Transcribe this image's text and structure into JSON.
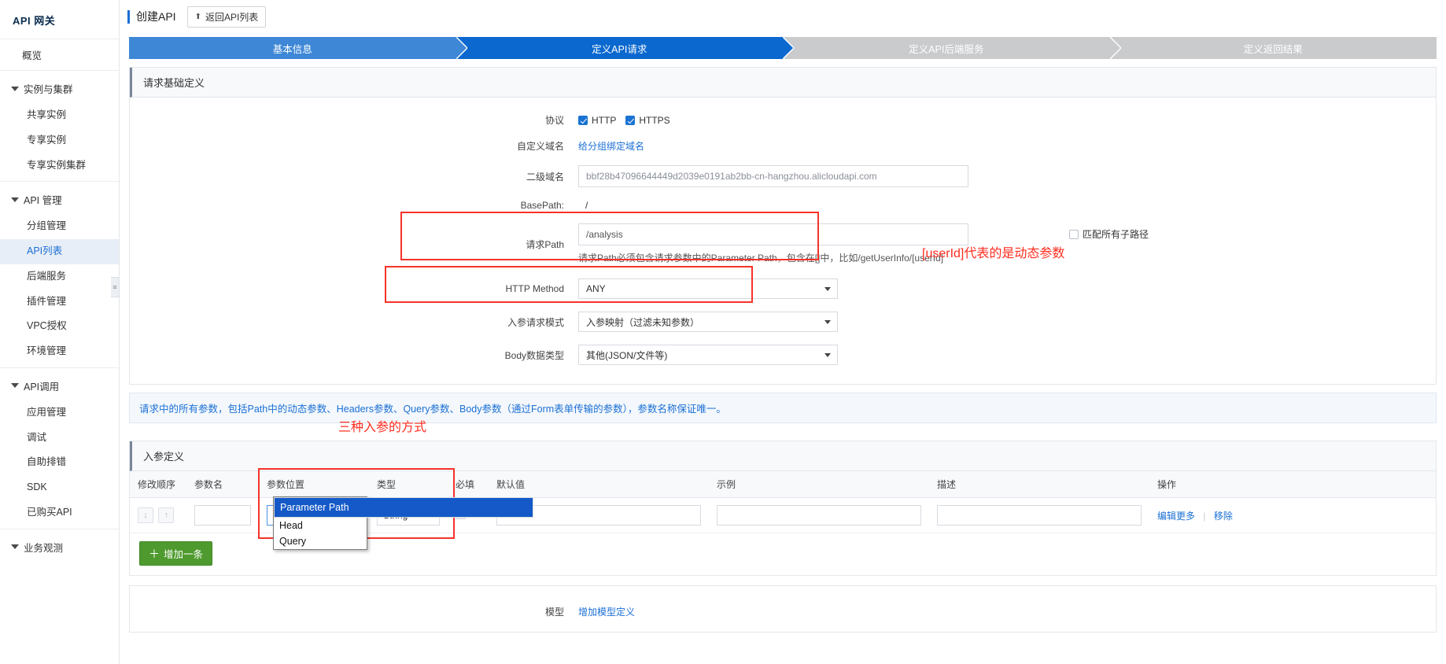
{
  "sidebar": {
    "brand": "API 网关",
    "overview": "概览",
    "groups": [
      {
        "title": "实例与集群",
        "items": [
          "共享实例",
          "专享实例",
          "专享实例集群"
        ]
      },
      {
        "title": "API 管理",
        "items": [
          "分组管理",
          "API列表",
          "后端服务",
          "插件管理",
          "VPC授权",
          "环境管理"
        ],
        "active": "API列表"
      },
      {
        "title": "API调用",
        "items": [
          "应用管理",
          "调试",
          "自助排错",
          "SDK",
          "已购买API"
        ]
      },
      {
        "title": "业务观测",
        "items": []
      }
    ],
    "collapse_icon": "collapse-handle-icon"
  },
  "header": {
    "title": "创建API",
    "back_button": "返回API列表",
    "back_icon": "upload-arrow-icon"
  },
  "steps": [
    {
      "label": "基本信息",
      "state": "done"
    },
    {
      "label": "定义API请求",
      "state": "active"
    },
    {
      "label": "定义API后端服务",
      "state": "todo"
    },
    {
      "label": "定义返回结果",
      "state": "todo"
    }
  ],
  "request_panel": {
    "title": "请求基础定义",
    "protocol_label": "协议",
    "protocol_options": [
      {
        "label": "HTTP",
        "checked": true
      },
      {
        "label": "HTTPS",
        "checked": true
      }
    ],
    "custom_domain_label": "自定义域名",
    "custom_domain_link": "给分组绑定域名",
    "second_domain_label": "二级域名",
    "second_domain_value": "bbf28b47096644449d2039e0191ab2bb-cn-hangzhou.alicloudapi.com",
    "basepath_label": "BasePath:",
    "basepath_value": "/",
    "path_label": "请求Path",
    "path_value": "/analysis",
    "path_hint": "请求Path必须包含请求参数中的Parameter Path，包含在[]中，比如/getUserInfo/[userId]",
    "match_subpath_label": "匹配所有子路径",
    "match_subpath_checked": false,
    "method_label": "HTTP Method",
    "method_value": "ANY",
    "param_mode_label": "入参请求模式",
    "param_mode_value": "入参映射（过滤未知参数）",
    "body_type_label": "Body数据类型",
    "body_type_value": "其他(JSON/文件等)"
  },
  "notice": "请求中的所有参数，包括Path中的动态参数、Headers参数、Query参数、Body参数（通过Form表单传输的参数），参数名称保证唯一。",
  "params_panel": {
    "title": "入参定义",
    "columns": [
      "修改顺序",
      "参数名",
      "参数位置",
      "类型",
      "必填",
      "默认值",
      "示例",
      "描述",
      "操作"
    ],
    "row": {
      "order_down_icon": "arrow-down-icon",
      "order_up_icon": "arrow-up-icon",
      "name_value": "",
      "position_value": "Parameter Path",
      "type_value": "String",
      "required_checked": true,
      "default_value": "",
      "example_value": "",
      "description_value": "",
      "actions": {
        "edit_more": "编辑更多",
        "remove": "移除",
        "separator": "|"
      }
    },
    "position_dropdown_options": [
      "Parameter Path",
      "Head",
      "Query"
    ],
    "position_dropdown_selected": "Parameter Path",
    "add_button": "增加一条",
    "add_icon": "plus-icon"
  },
  "bottom_panel": {
    "label": "模型",
    "link": "增加模型定义"
  },
  "annotations": [
    {
      "text": "[userId]代表的是动态参数",
      "color": "#ff2d20"
    },
    {
      "text": "三种入参的方式",
      "color": "#ff2d20"
    }
  ],
  "colors": {
    "accent_blue": "#1a6fd4",
    "step_active": "#0a68cf",
    "step_done": "#3d87d6",
    "step_todo": "#c9cbcd",
    "annotation_red": "#ff2d20",
    "add_green": "#4e9a2e"
  }
}
